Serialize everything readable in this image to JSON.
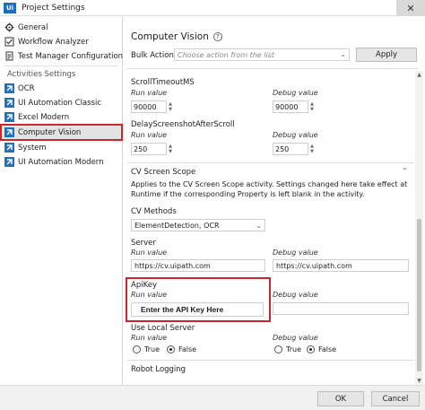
{
  "window": {
    "title": "Project Settings",
    "logo_text": "Ui",
    "close_glyph": "✕"
  },
  "sidebar": {
    "items_top": [
      {
        "label": "General",
        "icon": "gear-icon"
      },
      {
        "label": "Workflow Analyzer",
        "icon": "checklist-icon"
      },
      {
        "label": "Test Manager Configuration",
        "icon": "test-manager-icon"
      }
    ],
    "section_label": "Activities Settings",
    "activity_items": [
      {
        "label": "OCR",
        "icon": "activity-arrow-icon"
      },
      {
        "label": "UI Automation Classic",
        "icon": "activity-arrow-icon"
      },
      {
        "label": "Excel Modern",
        "icon": "activity-arrow-icon"
      },
      {
        "label": "Computer Vision",
        "icon": "activity-arrow-icon",
        "selected": true
      },
      {
        "label": "System",
        "icon": "activity-arrow-icon"
      },
      {
        "label": "UI Automation Modern",
        "icon": "activity-arrow-icon"
      }
    ],
    "highlight_color": "#c8282b",
    "icon_color": "#1b73c4"
  },
  "main": {
    "title": "Computer Vision",
    "help_glyph": "?",
    "bulk_action_label": "Bulk Action",
    "bulk_action_placeholder": "Choose action from the list",
    "apply_label": "Apply",
    "scroll_timeout": {
      "name": "ScrollTimeoutMS",
      "run_label": "Run value",
      "run_value": "90000",
      "debug_label": "Debug value",
      "debug_value": "90000"
    },
    "delay_after_scroll": {
      "name": "DelayScreenshotAfterScroll",
      "run_label": "Run value",
      "run_value": "250",
      "debug_label": "Debug value",
      "debug_value": "250"
    },
    "cv_screen_scope": {
      "title": "CV Screen Scope",
      "description": "Applies to the CV Screen Scope activity. Settings changed here take effect at Runtime if the corresponding Property is left blank in the activity."
    },
    "cv_methods": {
      "name": "CV Methods",
      "value": "ElementDetection, OCR"
    },
    "server": {
      "name": "Server",
      "run_label": "Run value",
      "run_value": "https://cv.uipath.com",
      "debug_label": "Debug value",
      "debug_value": "https://cv.uipath.com"
    },
    "api_key": {
      "name": "ApiKey",
      "run_label": "Run value",
      "run_value": "Enter the API Key Here",
      "debug_label": "Debug value"
    },
    "use_local_server": {
      "name": "Use Local Server",
      "run_label": "Run value",
      "debug_label": "Debug value",
      "true_label": "True",
      "false_label": "False",
      "run_selected": "False",
      "debug_selected": "False"
    },
    "robot_logging": {
      "title": "Robot Logging"
    }
  },
  "footer": {
    "ok_label": "OK",
    "cancel_label": "Cancel"
  }
}
